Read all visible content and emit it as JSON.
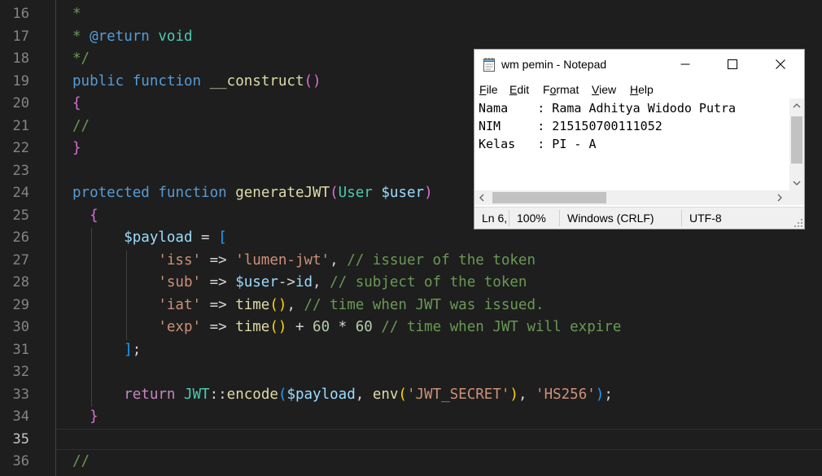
{
  "editor": {
    "lines": [
      {
        "num": "16",
        "tokens": [
          {
            "t": "*",
            "c": "t-comment"
          }
        ]
      },
      {
        "num": "17",
        "tokens": [
          {
            "t": "* ",
            "c": "t-comment"
          },
          {
            "t": "@return",
            "c": "t-doc"
          },
          {
            "t": " void",
            "c": "t-type"
          }
        ]
      },
      {
        "num": "18",
        "tokens": [
          {
            "t": "*/",
            "c": "t-comment"
          }
        ]
      },
      {
        "num": "19",
        "tokens": [
          {
            "t": "public",
            "c": "t-kw"
          },
          {
            "t": " ",
            "c": "t-op"
          },
          {
            "t": "function",
            "c": "t-kw"
          },
          {
            "t": " ",
            "c": "t-op"
          },
          {
            "t": "__construct",
            "c": "t-fn"
          },
          {
            "t": "()",
            "c": "b2"
          }
        ]
      },
      {
        "num": "20",
        "tokens": [
          {
            "t": "{",
            "c": "b2"
          }
        ]
      },
      {
        "num": "21",
        "tokens": [
          {
            "t": "//",
            "c": "t-comment"
          }
        ]
      },
      {
        "num": "22",
        "tokens": [
          {
            "t": "}",
            "c": "b2"
          }
        ]
      },
      {
        "num": "23",
        "tokens": []
      },
      {
        "num": "24",
        "tokens": [
          {
            "t": "protected",
            "c": "t-kw"
          },
          {
            "t": " ",
            "c": "t-op"
          },
          {
            "t": "function",
            "c": "t-kw"
          },
          {
            "t": " ",
            "c": "t-op"
          },
          {
            "t": "generateJWT",
            "c": "t-fn"
          },
          {
            "t": "(",
            "c": "b2"
          },
          {
            "t": "User",
            "c": "t-type"
          },
          {
            "t": " ",
            "c": "t-op"
          },
          {
            "t": "$user",
            "c": "t-var"
          },
          {
            "t": ")",
            "c": "b2"
          }
        ]
      },
      {
        "num": "25",
        "tokens": [
          {
            "t": "  ",
            "c": "t-op"
          },
          {
            "t": "{",
            "c": "b2"
          }
        ]
      },
      {
        "num": "26",
        "tokens": [
          {
            "t": "      ",
            "c": "t-op"
          },
          {
            "t": "$payload",
            "c": "t-var"
          },
          {
            "t": " = ",
            "c": "t-op"
          },
          {
            "t": "[",
            "c": "b3"
          }
        ]
      },
      {
        "num": "27",
        "tokens": [
          {
            "t": "          ",
            "c": "t-op"
          },
          {
            "t": "'iss'",
            "c": "t-str"
          },
          {
            "t": " => ",
            "c": "t-op"
          },
          {
            "t": "'lumen-jwt'",
            "c": "t-str"
          },
          {
            "t": ", ",
            "c": "t-op"
          },
          {
            "t": "// issuer of the token",
            "c": "t-comment"
          }
        ]
      },
      {
        "num": "28",
        "tokens": [
          {
            "t": "          ",
            "c": "t-op"
          },
          {
            "t": "'sub'",
            "c": "t-str"
          },
          {
            "t": " => ",
            "c": "t-op"
          },
          {
            "t": "$user",
            "c": "t-var"
          },
          {
            "t": "->",
            "c": "t-op"
          },
          {
            "t": "id",
            "c": "t-var"
          },
          {
            "t": ", ",
            "c": "t-op"
          },
          {
            "t": "// subject of the token",
            "c": "t-comment"
          }
        ]
      },
      {
        "num": "29",
        "tokens": [
          {
            "t": "          ",
            "c": "t-op"
          },
          {
            "t": "'iat'",
            "c": "t-str"
          },
          {
            "t": " => ",
            "c": "t-op"
          },
          {
            "t": "time",
            "c": "t-fn"
          },
          {
            "t": "()",
            "c": "b1"
          },
          {
            "t": ", ",
            "c": "t-op"
          },
          {
            "t": "// time when JWT was issued.",
            "c": "t-comment"
          }
        ]
      },
      {
        "num": "30",
        "tokens": [
          {
            "t": "          ",
            "c": "t-op"
          },
          {
            "t": "'exp'",
            "c": "t-str"
          },
          {
            "t": " => ",
            "c": "t-op"
          },
          {
            "t": "time",
            "c": "t-fn"
          },
          {
            "t": "()",
            "c": "b1"
          },
          {
            "t": " + ",
            "c": "t-op"
          },
          {
            "t": "60",
            "c": "t-num"
          },
          {
            "t": " * ",
            "c": "t-op"
          },
          {
            "t": "60",
            "c": "t-num"
          },
          {
            "t": " ",
            "c": "t-op"
          },
          {
            "t": "// time when JWT will expire",
            "c": "t-comment"
          }
        ]
      },
      {
        "num": "31",
        "tokens": [
          {
            "t": "      ",
            "c": "t-op"
          },
          {
            "t": "]",
            "c": "b3"
          },
          {
            "t": ";",
            "c": "t-op"
          }
        ]
      },
      {
        "num": "32",
        "tokens": []
      },
      {
        "num": "33",
        "tokens": [
          {
            "t": "      ",
            "c": "t-op"
          },
          {
            "t": "return",
            "c": "t-ctrl"
          },
          {
            "t": " ",
            "c": "t-op"
          },
          {
            "t": "JWT",
            "c": "t-type"
          },
          {
            "t": "::",
            "c": "t-op"
          },
          {
            "t": "encode",
            "c": "t-fn"
          },
          {
            "t": "(",
            "c": "b3"
          },
          {
            "t": "$payload",
            "c": "t-var"
          },
          {
            "t": ", ",
            "c": "t-op"
          },
          {
            "t": "env",
            "c": "t-fn"
          },
          {
            "t": "(",
            "c": "b1"
          },
          {
            "t": "'JWT_SECRET'",
            "c": "t-str"
          },
          {
            "t": ")",
            "c": "b1"
          },
          {
            "t": ", ",
            "c": "t-op"
          },
          {
            "t": "'HS256'",
            "c": "t-str"
          },
          {
            "t": ")",
            "c": "b3"
          },
          {
            "t": ";",
            "c": "t-op"
          }
        ]
      },
      {
        "num": "34",
        "tokens": [
          {
            "t": "  ",
            "c": "t-op"
          },
          {
            "t": "}",
            "c": "b2"
          }
        ]
      },
      {
        "num": "35",
        "tokens": [],
        "current": true
      },
      {
        "num": "36",
        "tokens": [
          {
            "t": "//",
            "c": "t-comment"
          }
        ]
      }
    ]
  },
  "notepad": {
    "title": "wm pemin - Notepad",
    "menu": [
      {
        "key": "F",
        "rest": "ile"
      },
      {
        "key": "E",
        "rest": "dit"
      },
      {
        "key": "o",
        "pre": "F",
        "rest": "rmat"
      },
      {
        "key": "V",
        "rest": "iew"
      },
      {
        "key": "H",
        "rest": "elp"
      }
    ],
    "content": [
      "Nama    : Rama Adhitya Widodo Putra",
      "NIM     : 215150700111052",
      "Kelas   : PI - A"
    ],
    "status": {
      "position": "Ln 6,",
      "zoom": "100%",
      "line_ending": "Windows (CRLF)",
      "encoding": "UTF-8"
    }
  }
}
